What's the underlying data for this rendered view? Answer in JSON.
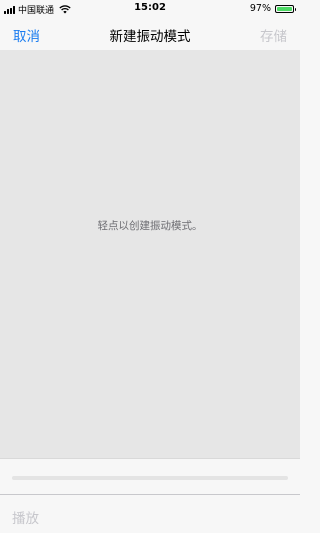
{
  "status_bar": {
    "carrier": "中国联通",
    "time": "15:02",
    "battery_percent": "97%",
    "battery_level": 0.97,
    "battery_color": "#4cd964"
  },
  "nav": {
    "cancel_label": "取消",
    "title": "新建振动模式",
    "save_label": "存储"
  },
  "canvas": {
    "hint": "轻点以创建振动模式。"
  },
  "toolbar": {
    "play_label": "播放"
  },
  "colors": {
    "accent": "#1a7cf0",
    "disabled": "#c7c7cc",
    "canvas_bg": "#e6e6e6"
  }
}
